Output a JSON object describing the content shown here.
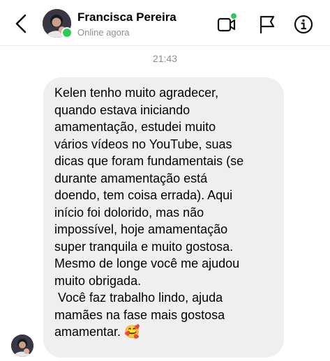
{
  "header": {
    "contact_name": "Francisca Pereira",
    "status": "Online agora",
    "icons": {
      "back": "chevron-left-icon",
      "video": "video-camera-icon",
      "flag": "flag-icon",
      "info": "info-icon"
    },
    "online_color": "#2ec95c"
  },
  "chat": {
    "timestamp": "21:43",
    "message": {
      "text": "Kelen tenho muito agradecer,\nquando estava iniciando\namamentação, estudei muito\nvários vídeos no YouTube, suas\ndicas que foram fundamentais (se\ndurante amamentação está\ndoendo, tem coisa errada). Aqui\ninício foi dolorido, mas não\nimpossível, hoje amamentação\nsuper tranquila e muito gostosa.\nMesmo de longe você me ajudou\nmuito obrigada.\n Você faz trabalho lindo, ajuda\nmamães na fase mais gostosa\namamentar. ",
      "emoji": "🥰",
      "bubble_color": "#efefef"
    }
  }
}
